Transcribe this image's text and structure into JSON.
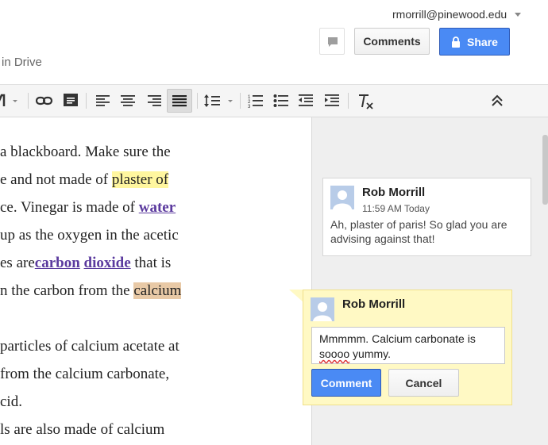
{
  "header": {
    "user_email": "rmorrill@pinewood.edu",
    "drive_text": "in Drive",
    "comments_label": "Comments",
    "share_label": "Share"
  },
  "toolbar": {
    "icons": [
      "text-color-icon",
      "link-icon",
      "insert-comment-icon",
      "align-left-icon",
      "align-center-icon",
      "align-right-icon",
      "align-justify-icon",
      "line-spacing-icon",
      "numbered-list-icon",
      "bulleted-list-icon",
      "decrease-indent-icon",
      "increase-indent-icon",
      "clear-formatting-icon",
      "collapse-toolbar-icon"
    ]
  },
  "document": {
    "lines": [
      {
        "parts": [
          {
            "t": " a blackboard. Make sure the"
          }
        ]
      },
      {
        "parts": [
          {
            "t": "e and not made of "
          },
          {
            "t": "plaster of",
            "s": "yellow"
          }
        ]
      },
      {
        "parts": [
          {
            "t": "ce. Vinegar is made of "
          },
          {
            "t": "water",
            "s": "link"
          }
        ]
      },
      {
        "parts": [
          {
            "t": " up as the oxygen in the acetic"
          }
        ]
      },
      {
        "parts": [
          {
            "t": "es are"
          },
          {
            "t": "carbon",
            "s": "link"
          },
          {
            "t": " "
          },
          {
            "t": "dioxide",
            "s": "link"
          },
          {
            "t": " that is"
          }
        ]
      },
      {
        "parts": [
          {
            "t": "n the carbon from the "
          },
          {
            "t": "calcium",
            "s": "tan"
          }
        ]
      },
      {
        "parts": [
          {
            "t": ""
          }
        ]
      },
      {
        "parts": [
          {
            "t": "particles of calcium acetate at"
          }
        ]
      },
      {
        "parts": [
          {
            "t": " from the calcium carbonate,"
          }
        ]
      },
      {
        "parts": [
          {
            "t": "cid."
          }
        ]
      },
      {
        "parts": [
          {
            "t": "ls are also made of calcium"
          }
        ]
      }
    ]
  },
  "comments": [
    {
      "author": "Rob Morrill",
      "time": "11:59 AM Today",
      "text": "Ah, plaster of paris! So glad you are advising against that!"
    }
  ],
  "reply": {
    "author": "Rob Morrill",
    "text_before": "Mmmmm.  Calcium carbonate is ",
    "text_misspelled": "soooo",
    "text_after": " yummy.",
    "submit_label": "Comment",
    "cancel_label": "Cancel"
  },
  "colors": {
    "accent": "#4a8af4",
    "comment_highlight": "#fff69f",
    "active_comment_highlight": "#e8c9a6",
    "link": "#5b3a9e"
  }
}
